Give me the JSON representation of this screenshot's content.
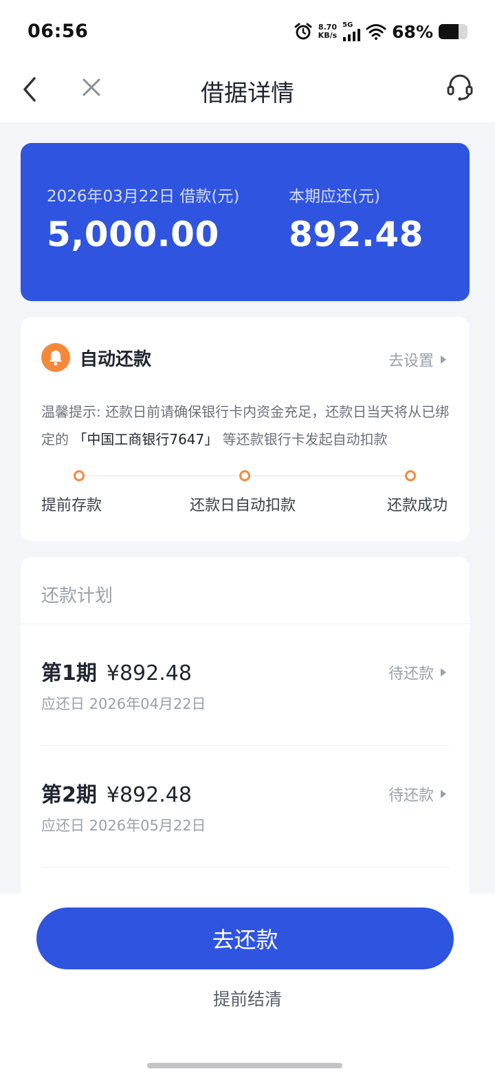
{
  "status_bar": {
    "time": "06:56",
    "net_speed_value": "8.70",
    "net_speed_unit": "KB/s",
    "network": "5G",
    "battery_percent": "68%",
    "battery_level": 0.68
  },
  "nav": {
    "title": "借据详情",
    "back_icon": "chevron-left-icon",
    "close_icon": "close-icon",
    "service_icon": "customer-service-icon"
  },
  "summary": {
    "loan_label": "2026年03月22日 借款(元)",
    "loan_amount": "5,000.00",
    "due_label": "本期应还(元)",
    "due_amount": "892.48"
  },
  "auto_repay": {
    "title": "自动还款",
    "set_link": "去设置",
    "tip_prefix": "温馨提示: 还款日前请确保银行卡内资金充足，还款日当天将从已绑定的",
    "tip_bank": "「中国工商银行7647」",
    "tip_suffix": "等还款银行卡发起自动扣款",
    "steps": [
      "提前存款",
      "还款日自动扣款",
      "还款成功"
    ]
  },
  "plan": {
    "title": "还款计划",
    "items": [
      {
        "period": "第1期",
        "amount": "¥892.48",
        "due": "应还日 2026年04月22日",
        "status": "待还款"
      },
      {
        "period": "第2期",
        "amount": "¥892.48",
        "due": "应还日 2026年05月22日",
        "status": "待还款"
      }
    ]
  },
  "actions": {
    "pay_button": "去还款",
    "settle_link": "提前结清"
  },
  "colors": {
    "primary": "#2f54e0",
    "accent_orange": "#f6883a",
    "background": "#f4f5f9"
  }
}
